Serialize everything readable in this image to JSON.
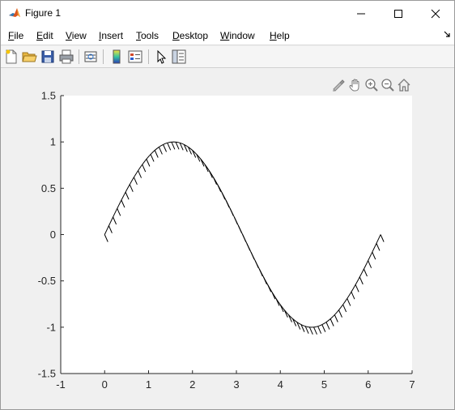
{
  "window": {
    "title": "Figure 1",
    "controls": {
      "minimize": "minimize",
      "maximize": "maximize",
      "close": "close"
    }
  },
  "menubar": {
    "items": [
      {
        "underline": "F",
        "rest": "ile"
      },
      {
        "underline": "E",
        "rest": "dit"
      },
      {
        "underline": "V",
        "rest": "iew"
      },
      {
        "underline": "I",
        "rest": "nsert"
      },
      {
        "underline": "T",
        "rest": "ools"
      },
      {
        "underline": "D",
        "rest": "esktop"
      },
      {
        "underline": "W",
        "rest": "indow"
      },
      {
        "underline": "H",
        "rest": "elp"
      }
    ],
    "overflow_icon": "arrow-icon"
  },
  "toolbar": {
    "icons": [
      "new-figure-icon",
      "open-file-icon",
      "save-icon",
      "print-icon",
      "link-plot-icon",
      "colorbar-icon",
      "legend-icon",
      "edit-plot-icon",
      "property-inspector-icon"
    ]
  },
  "axes_toolbar": {
    "icons": [
      "brush-icon",
      "pan-icon",
      "zoom-in-icon",
      "zoom-out-icon",
      "home-icon"
    ]
  },
  "chart_data": {
    "type": "line",
    "title": "",
    "xlabel": "",
    "ylabel": "",
    "xlim": [
      -1,
      7
    ],
    "ylim": [
      -1.5,
      1.5
    ],
    "xticks": [
      "-1",
      "0",
      "1",
      "2",
      "3",
      "4",
      "5",
      "6",
      "7"
    ],
    "yticks": [
      "1.5",
      "1",
      "0.5",
      "0",
      "-0.5",
      "-1",
      "-1.5"
    ],
    "grid": false,
    "series": [
      {
        "function": "y = sin(x)",
        "x_range": [
          0,
          6.2832
        ],
        "color": "#000000",
        "style": "solid with hatch marks on underside"
      }
    ]
  }
}
